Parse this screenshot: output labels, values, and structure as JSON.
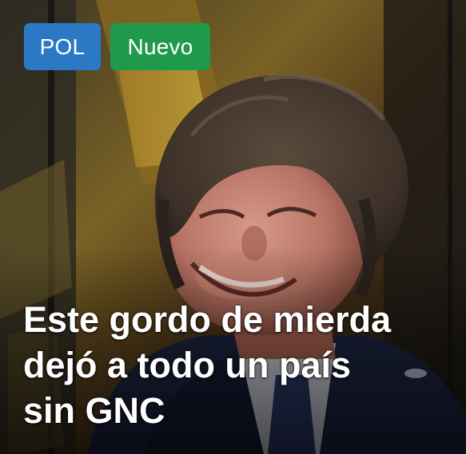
{
  "post": {
    "badges": {
      "category": "POL",
      "status": "Nuevo"
    },
    "headline_lines": [
      "Este gordo de mierda",
      "dejó a todo un país",
      "sin GNC"
    ]
  },
  "colors": {
    "category_badge": "#2b79c4",
    "status_badge": "#1f9a4a",
    "headline_text": "#ffffff"
  }
}
